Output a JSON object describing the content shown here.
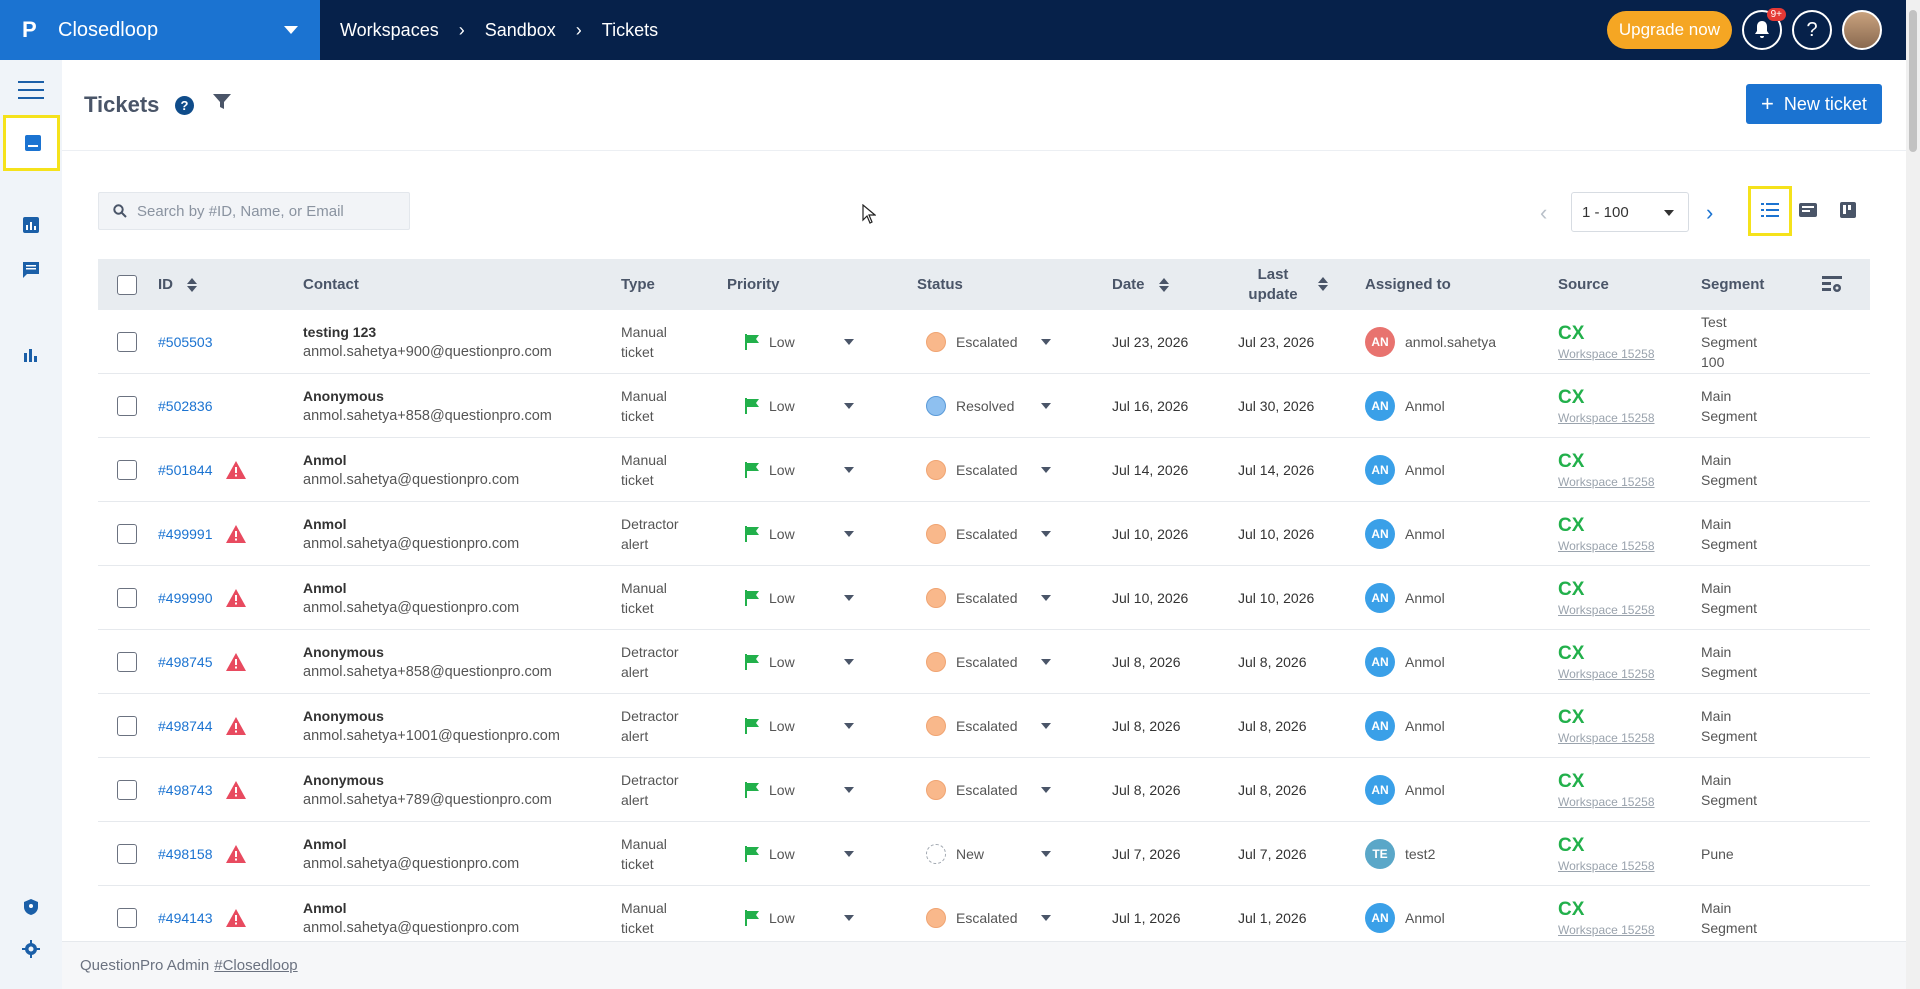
{
  "app": {
    "logo": "P",
    "name": "Closedloop"
  },
  "breadcrumbs": [
    "Workspaces",
    "Sandbox",
    "Tickets"
  ],
  "top_actions": {
    "upgrade": "Upgrade now",
    "notif_badge": "9+",
    "help": "?"
  },
  "page": {
    "title": "Tickets",
    "new_ticket": "New ticket"
  },
  "search": {
    "placeholder": "Search by #ID, Name, or Email"
  },
  "pager": {
    "range": "1 - 100"
  },
  "columns": {
    "id": "ID",
    "contact": "Contact",
    "type": "Type",
    "priority": "Priority",
    "status": "Status",
    "date": "Date",
    "last_update": "Last update",
    "assigned_to": "Assigned to",
    "source": "Source",
    "segment": "Segment"
  },
  "colors": {
    "flag": "#22b04b",
    "warn": "#e84a5f",
    "accent": "#1b73d1",
    "source": "#22b04b"
  },
  "rows": [
    {
      "id": "#505503",
      "warn": false,
      "name": "testing 123",
      "email": "anmol.sahetya+900@questionpro.com",
      "type": "Manual ticket",
      "priority": "Low",
      "status": "Escalated",
      "status_kind": "escalated",
      "date": "Jul 23, 2026",
      "last_update": "Jul 23, 2026",
      "av": "AN",
      "av_color": "#e8736f",
      "assignee": "anmol.sahetya",
      "source": "CX",
      "workspace": "Workspace 15258",
      "segment": "Test Segment 100"
    },
    {
      "id": "#502836",
      "warn": false,
      "name": "Anonymous",
      "email": "anmol.sahetya+858@questionpro.com",
      "type": "Manual ticket",
      "priority": "Low",
      "status": "Resolved",
      "status_kind": "resolved",
      "date": "Jul 16, 2026",
      "last_update": "Jul 30, 2026",
      "av": "AN",
      "av_color": "#3aa0e8",
      "assignee": "Anmol",
      "source": "CX",
      "workspace": "Workspace 15258",
      "segment": "Main Segment"
    },
    {
      "id": "#501844",
      "warn": true,
      "name": "Anmol",
      "email": "anmol.sahetya@questionpro.com",
      "type": "Manual ticket",
      "priority": "Low",
      "status": "Escalated",
      "status_kind": "escalated",
      "date": "Jul 14, 2026",
      "last_update": "Jul 14, 2026",
      "av": "AN",
      "av_color": "#3aa0e8",
      "assignee": "Anmol",
      "source": "CX",
      "workspace": "Workspace 15258",
      "segment": "Main Segment"
    },
    {
      "id": "#499991",
      "warn": true,
      "name": "Anmol",
      "email": "anmol.sahetya@questionpro.com",
      "type": "Detractor alert",
      "priority": "Low",
      "status": "Escalated",
      "status_kind": "escalated",
      "date": "Jul 10, 2026",
      "last_update": "Jul 10, 2026",
      "av": "AN",
      "av_color": "#3aa0e8",
      "assignee": "Anmol",
      "source": "CX",
      "workspace": "Workspace 15258",
      "segment": "Main Segment"
    },
    {
      "id": "#499990",
      "warn": true,
      "name": "Anmol",
      "email": "anmol.sahetya@questionpro.com",
      "type": "Manual ticket",
      "priority": "Low",
      "status": "Escalated",
      "status_kind": "escalated",
      "date": "Jul 10, 2026",
      "last_update": "Jul 10, 2026",
      "av": "AN",
      "av_color": "#3aa0e8",
      "assignee": "Anmol",
      "source": "CX",
      "workspace": "Workspace 15258",
      "segment": "Main Segment"
    },
    {
      "id": "#498745",
      "warn": true,
      "name": "Anonymous",
      "email": "anmol.sahetya+858@questionpro.com",
      "type": "Detractor alert",
      "priority": "Low",
      "status": "Escalated",
      "status_kind": "escalated",
      "date": "Jul 8, 2026",
      "last_update": "Jul 8, 2026",
      "av": "AN",
      "av_color": "#3aa0e8",
      "assignee": "Anmol",
      "source": "CX",
      "workspace": "Workspace 15258",
      "segment": "Main Segment"
    },
    {
      "id": "#498744",
      "warn": true,
      "name": "Anonymous",
      "email": "anmol.sahetya+1001@questionpro.com",
      "type": "Detractor alert",
      "priority": "Low",
      "status": "Escalated",
      "status_kind": "escalated",
      "date": "Jul 8, 2026",
      "last_update": "Jul 8, 2026",
      "av": "AN",
      "av_color": "#3aa0e8",
      "assignee": "Anmol",
      "source": "CX",
      "workspace": "Workspace 15258",
      "segment": "Main Segment"
    },
    {
      "id": "#498743",
      "warn": true,
      "name": "Anonymous",
      "email": "anmol.sahetya+789@questionpro.com",
      "type": "Detractor alert",
      "priority": "Low",
      "status": "Escalated",
      "status_kind": "escalated",
      "date": "Jul 8, 2026",
      "last_update": "Jul 8, 2026",
      "av": "AN",
      "av_color": "#3aa0e8",
      "assignee": "Anmol",
      "source": "CX",
      "workspace": "Workspace 15258",
      "segment": "Main Segment"
    },
    {
      "id": "#498158",
      "warn": true,
      "name": "Anmol",
      "email": "anmol.sahetya@questionpro.com",
      "type": "Manual ticket",
      "priority": "Low",
      "status": "New",
      "status_kind": "new",
      "date": "Jul 7, 2026",
      "last_update": "Jul 7, 2026",
      "av": "TE",
      "av_color": "#5aa7c8",
      "assignee": "test2",
      "source": "CX",
      "workspace": "Workspace 15258",
      "segment": "Pune"
    },
    {
      "id": "#494143",
      "warn": true,
      "name": "Anmol",
      "email": "anmol.sahetya@questionpro.com",
      "type": "Manual ticket",
      "priority": "Low",
      "status": "Escalated",
      "status_kind": "escalated",
      "date": "Jul 1, 2026",
      "last_update": "Jul 1, 2026",
      "av": "AN",
      "av_color": "#3aa0e8",
      "assignee": "Anmol",
      "source": "CX",
      "workspace": "Workspace 15258",
      "segment": "Main Segment"
    }
  ],
  "footer": {
    "text": "QuestionPro Admin",
    "link": "#Closedloop"
  }
}
